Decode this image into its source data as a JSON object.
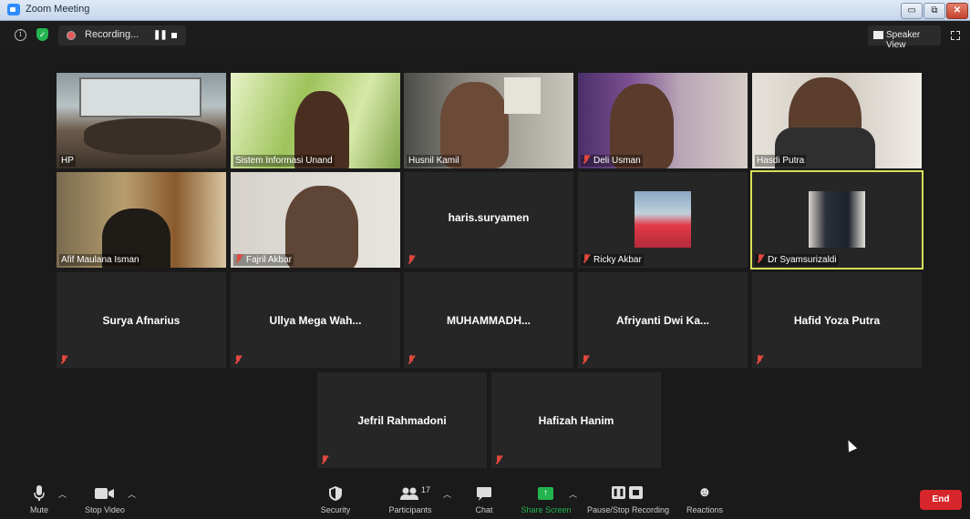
{
  "window": {
    "title": "Zoom Meeting",
    "buttons": [
      "▭",
      "⧉",
      "✕"
    ]
  },
  "topbar": {
    "recording_label": "Recording...",
    "speaker_view_label": "Speaker View"
  },
  "participants": [
    {
      "name": "HP",
      "video": true
    },
    {
      "name": "Sistem Informasi Unand",
      "video": true
    },
    {
      "name": "Husnil Kamil",
      "video": true
    },
    {
      "name": "Deli Usman",
      "video": true,
      "muted": true
    },
    {
      "name": "Hasdi Putra",
      "video": true
    },
    {
      "name": "Afif Maulana Isman",
      "video": true
    },
    {
      "name": "Fajril Akbar",
      "video": true,
      "muted": true
    },
    {
      "name": "haris.suryamen",
      "video": false,
      "muted": true
    },
    {
      "name": "Ricky Akbar",
      "video": false,
      "muted": true,
      "avatar": true
    },
    {
      "name": "Dr Syamsurizaldi",
      "video": false,
      "muted": true,
      "avatar": true,
      "active_speaker": true
    },
    {
      "name": "Surya Afnarius",
      "video": false,
      "muted": true
    },
    {
      "name": "Ullya Mega Wah...",
      "video": false,
      "muted": true
    },
    {
      "name": "MUHAMMADH...",
      "video": false,
      "muted": true
    },
    {
      "name": "Afriyanti Dwi Ka...",
      "video": false,
      "muted": true
    },
    {
      "name": "Hafid Yoza Putra",
      "video": false,
      "muted": true
    },
    {
      "name": "Jefril Rahmadoni",
      "video": false,
      "muted": true
    },
    {
      "name": "Hafizah Hanim",
      "video": false,
      "muted": true
    }
  ],
  "toolbar": {
    "mute": "Mute",
    "stop_video": "Stop Video",
    "security": "Security",
    "participants": "Participants",
    "participants_count": "17",
    "chat": "Chat",
    "share_screen": "Share Screen",
    "pause_stop_recording": "Pause/Stop Recording",
    "reactions": "Reactions",
    "end": "End"
  },
  "colors": {
    "share_green": "#23b450",
    "end_red": "#d7262b",
    "mute_red": "#e0483e",
    "active_border": "#d9df55"
  }
}
